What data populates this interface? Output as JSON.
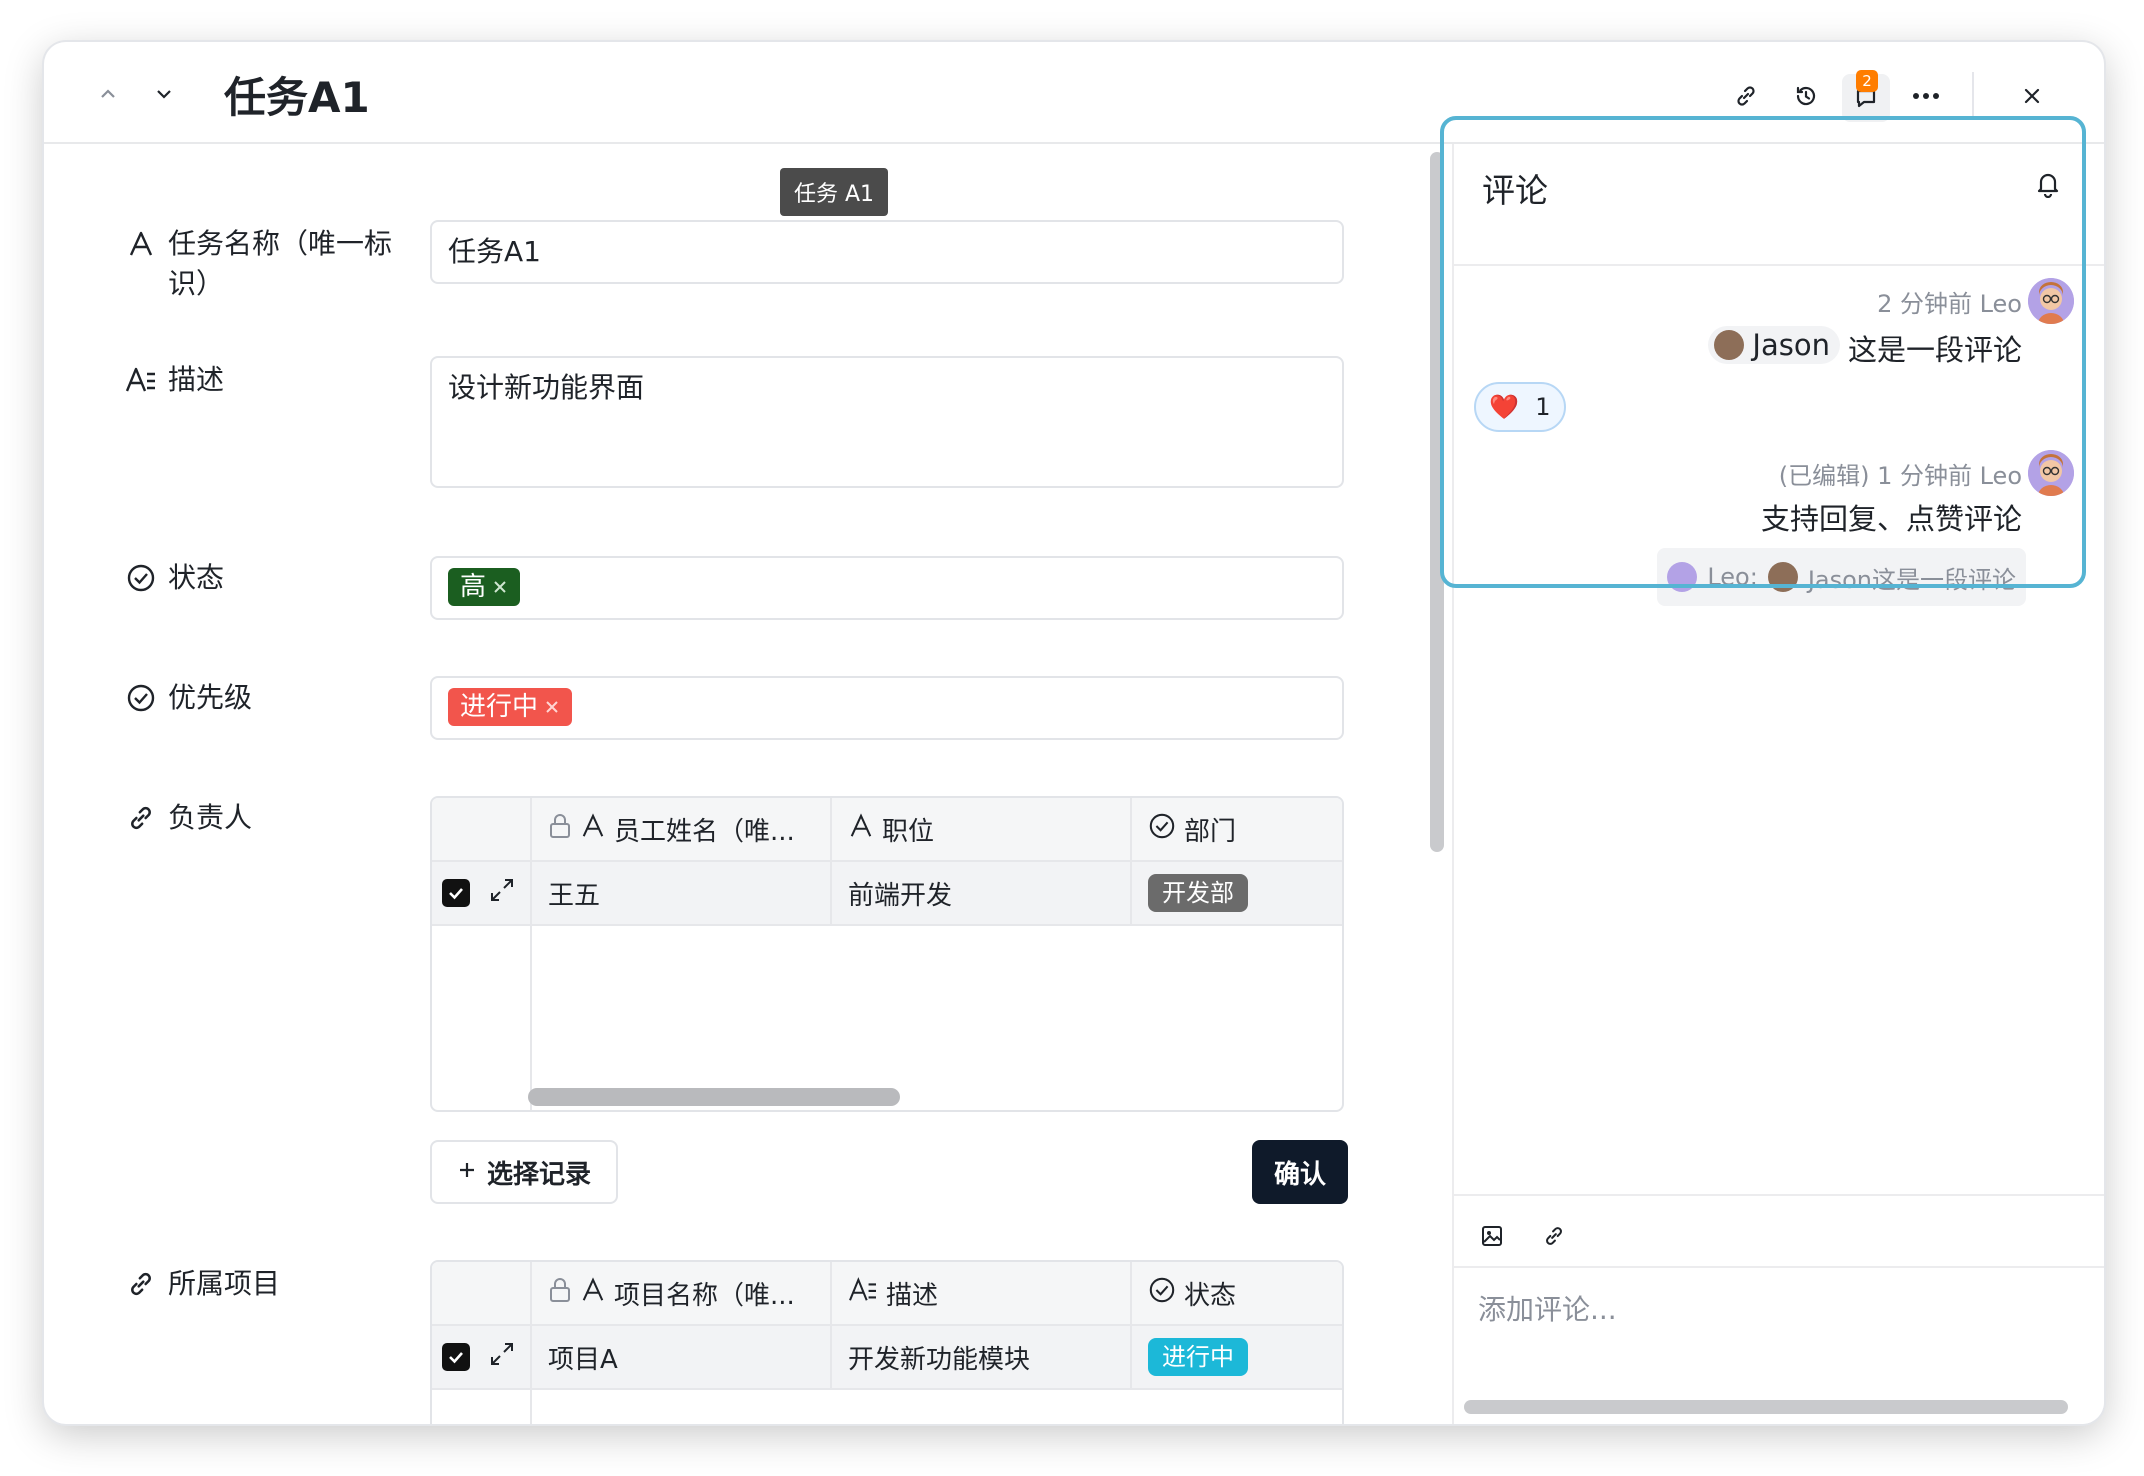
{
  "window": {
    "title": "任务A1",
    "comment_badge": "2"
  },
  "tooltip": "任务 A1",
  "fields": {
    "name": {
      "label": "任务名称（唯一标识）",
      "value": "任务A1"
    },
    "description": {
      "label": "描述",
      "value": "设计新功能界面"
    },
    "status": {
      "label": "状态",
      "tag": "高",
      "tag_color": "#1b5e20"
    },
    "priority": {
      "label": "优先级",
      "tag": "进行中",
      "tag_color": "#f2554c"
    },
    "assignee": {
      "label": "负责人",
      "columns": [
        "员工姓名（唯...",
        "职位",
        "部门"
      ],
      "rows": [
        {
          "name": "王五",
          "position": "前端开发",
          "department": "开发部"
        }
      ],
      "chip_color": "#6b6b6b",
      "select_button": "选择记录",
      "confirm_button": "确认"
    },
    "project": {
      "label": "所属项目",
      "columns": [
        "项目名称（唯...",
        "描述",
        "状态"
      ],
      "rows": [
        {
          "name": "项目A",
          "description": "开发新功能模块",
          "status": "进行中"
        }
      ],
      "chip_color": "#1cb8d8"
    }
  },
  "comments_panel": {
    "title": "评论",
    "comments": [
      {
        "meta": "2 分钟前 Leo",
        "mention": "Jason",
        "text": "这是一段评论",
        "reaction_emoji": "❤️",
        "reaction_count": "1"
      },
      {
        "meta": "(已编辑) 1 分钟前 Leo",
        "text": "支持回复、点赞评论",
        "reply_author": "Leo:",
        "reply_mention": "Jason这是一段评论"
      }
    ],
    "input_placeholder": "添加评论..."
  },
  "colors": {
    "accent_highlight": "#56b4d3",
    "confirm_bg": "#0f1a2a"
  }
}
